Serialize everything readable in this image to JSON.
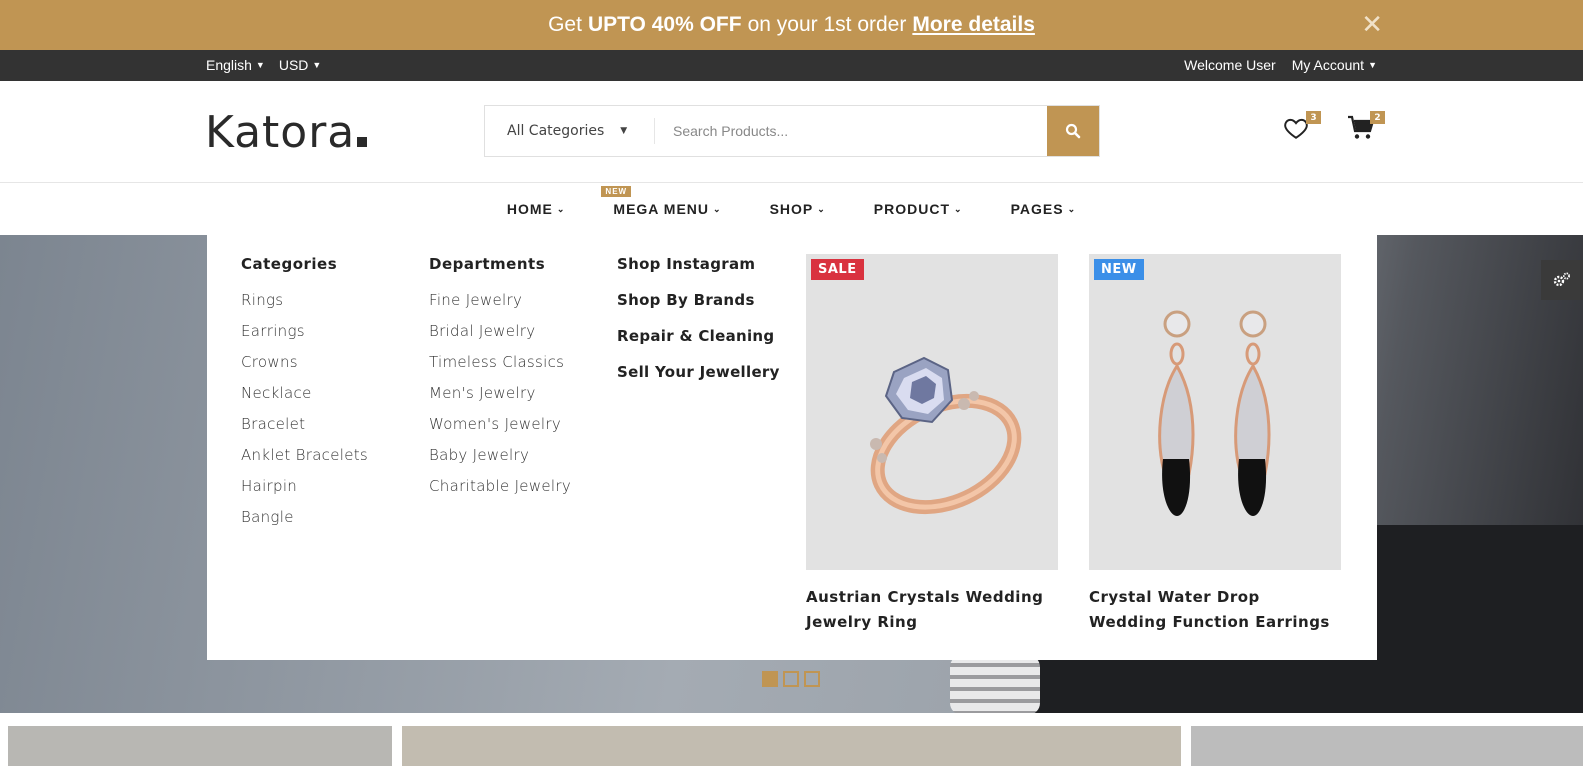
{
  "promo": {
    "pre": "Get",
    "bold": "UPTO 40% OFF",
    "post": "on your 1st order",
    "link": "More details",
    "close": "✕"
  },
  "utility": {
    "language": "English",
    "currency": "USD",
    "welcome": "Welcome User",
    "account": "My Account"
  },
  "header": {
    "logo": "Katora",
    "category_select": "All Categories",
    "search_placeholder": "Search Products...",
    "wishlist_count": "3",
    "cart_count": "2"
  },
  "nav": {
    "items": [
      "HOME",
      "MEGA MENU",
      "SHOP",
      "PRODUCT",
      "PAGES"
    ],
    "new_tag": "NEW"
  },
  "mega": {
    "categories": {
      "title": "Categories",
      "items": [
        "Rings",
        "Earrings",
        "Crowns",
        "Necklace",
        "Bracelet",
        "Anklet Bracelets",
        "Hairpin",
        "Bangle"
      ]
    },
    "departments": {
      "title": "Departments",
      "items": [
        "Fine Jewelry",
        "Bridal Jewelry",
        "Timeless Classics",
        "Men's Jewelry",
        "Women's Jewelry",
        "Baby Jewelry",
        "Charitable Jewelry"
      ]
    },
    "links": [
      "Shop Instagram",
      "Shop By Brands",
      "Repair & Cleaning",
      "Sell Your Jewellery"
    ],
    "products": [
      {
        "tag": "SALE",
        "tag_color": "#d9323f",
        "title": "Austrian Crystals Wedding Jewelry Ring"
      },
      {
        "tag": "NEW",
        "tag_color": "#3b8fe8",
        "title": "Crystal Water Drop Wedding Function Earrings"
      }
    ]
  },
  "colors": {
    "accent": "#c09553",
    "dark_bar": "#333333"
  }
}
